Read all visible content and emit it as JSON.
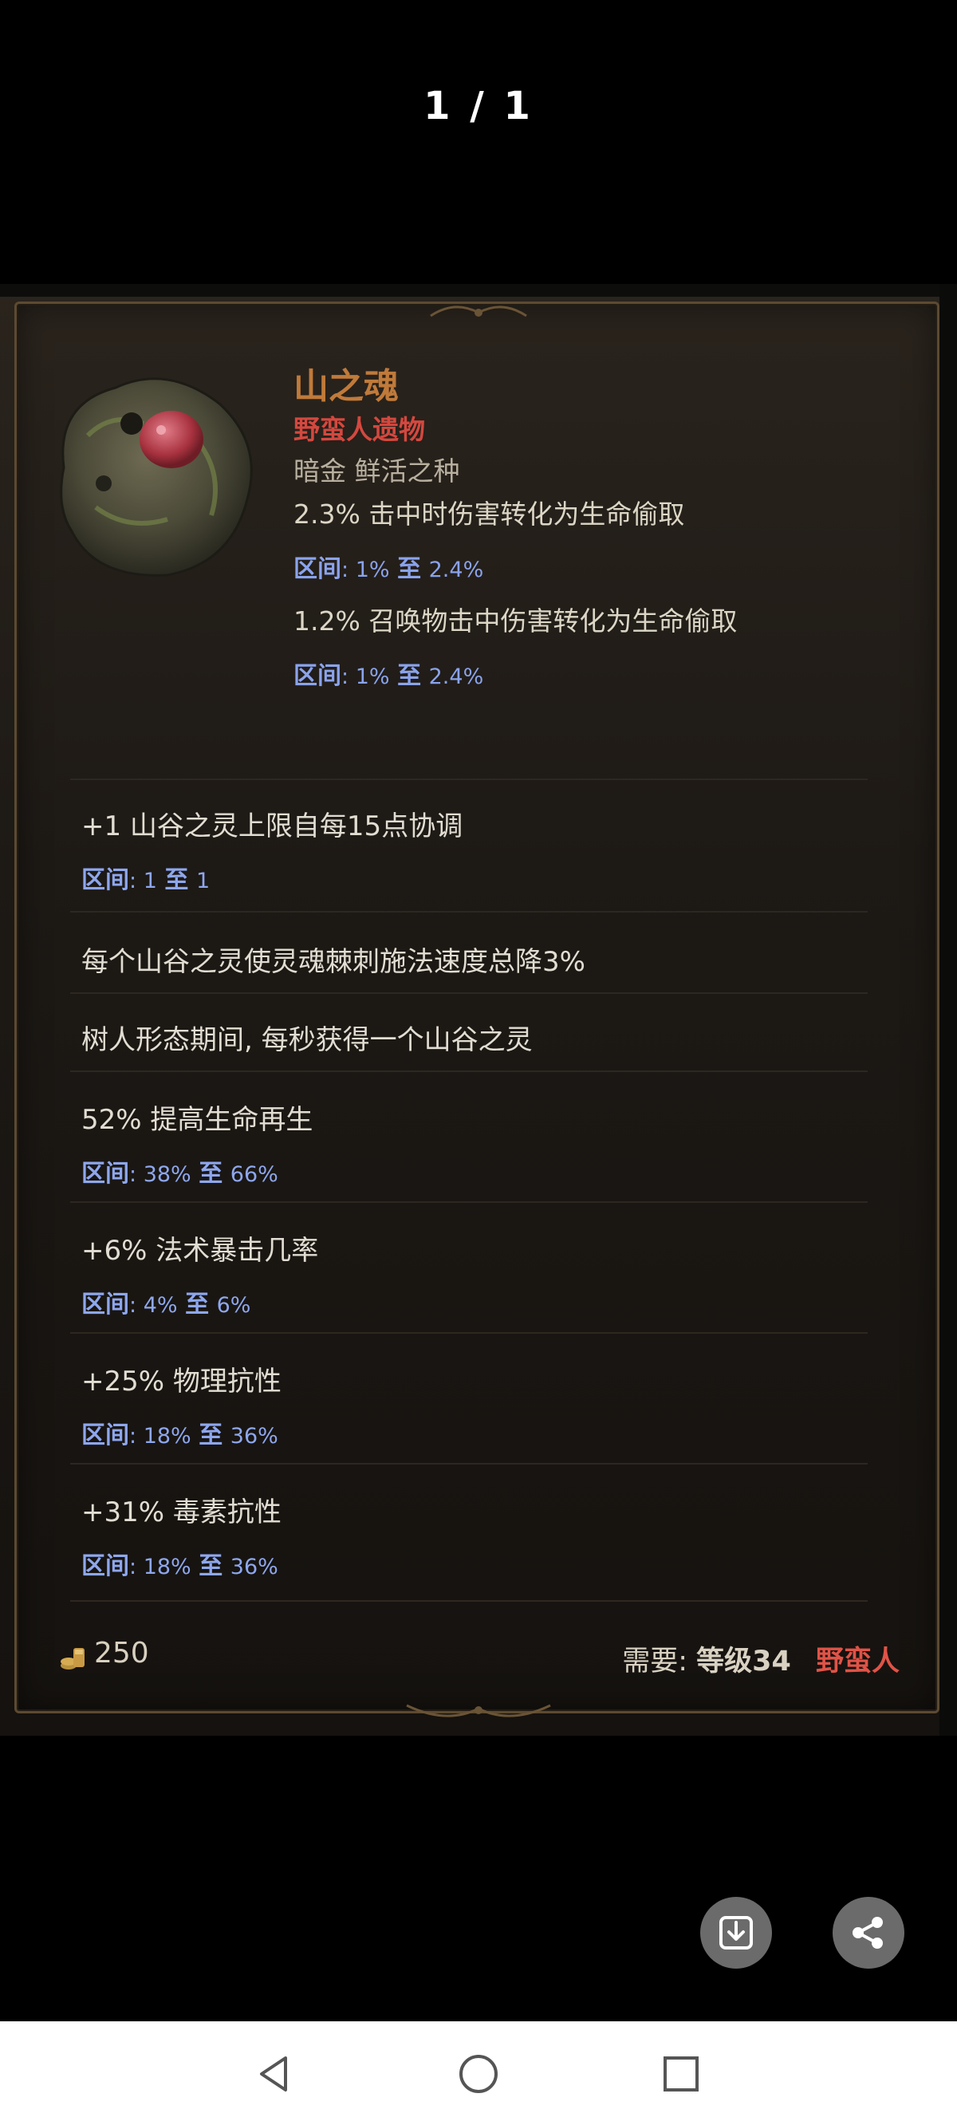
{
  "viewer": {
    "counter": "1 / 1"
  },
  "item": {
    "name": "山之魂",
    "type": "野蛮人遗物",
    "subtype": "暗金 鲜活之种",
    "implicits": [
      {
        "text": "2.3% 击中时伤害转化为生命偷取",
        "range_label": "区间",
        "range_min": "1%",
        "range_to": "至",
        "range_max": "2.4%"
      },
      {
        "text": "1.2% 召唤物击中伤害转化为生命偷取",
        "range_label": "区间",
        "range_min": "1%",
        "range_to": "至",
        "range_max": "2.4%"
      }
    ],
    "mods": [
      {
        "text": "+1 山谷之灵上限自每15点协调",
        "range_label": "区间",
        "range_min": "1",
        "range_to": "至",
        "range_max": "1"
      },
      {
        "text": "每个山谷之灵使灵魂棘刺施法速度总降3%"
      },
      {
        "text": "树人形态期间, 每秒获得一个山谷之灵"
      },
      {
        "text": "52% 提高生命再生",
        "range_label": "区间",
        "range_min": "38%",
        "range_to": "至",
        "range_max": "66%"
      },
      {
        "text": "+6% 法术暴击几率",
        "range_label": "区间",
        "range_min": "4%",
        "range_to": "至",
        "range_max": "6%"
      },
      {
        "text": "+25% 物理抗性",
        "range_label": "区间",
        "range_min": "18%",
        "range_to": "至",
        "range_max": "36%"
      },
      {
        "text": "+31% 毒素抗性",
        "range_label": "区间",
        "range_min": "18%",
        "range_to": "至",
        "range_max": "36%"
      }
    ],
    "gold_value": "250",
    "requirement": {
      "label": "需要:",
      "level": "等级34",
      "class": "野蛮人"
    }
  },
  "colors": {
    "item_name": "#c07a3a",
    "item_type": "#d4483f",
    "range_text": "#8ea7ee",
    "class_req": "#e05347"
  },
  "icons": {
    "gold": "gold-coins-icon",
    "download": "download-icon",
    "share": "share-icon",
    "nav_back": "back-triangle-icon",
    "nav_home": "home-circle-icon",
    "nav_recent": "recent-square-icon"
  }
}
